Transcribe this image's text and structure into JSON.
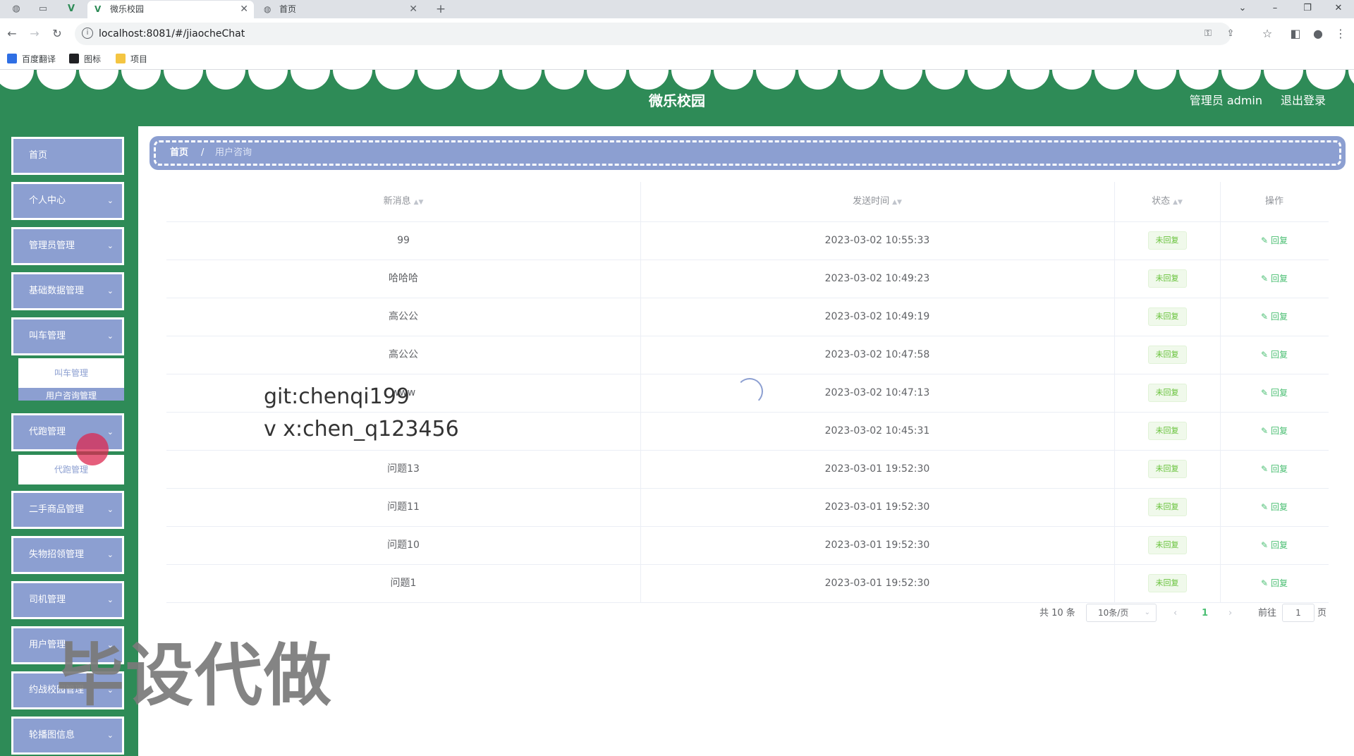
{
  "browser": {
    "tabs": [
      {
        "title": "微乐校园",
        "active": true
      },
      {
        "title": "首页",
        "active": false
      }
    ],
    "url": "localhost:8081/#/jiaocheChat",
    "bookmarks": [
      "百度翻译",
      "图标",
      "项目"
    ]
  },
  "header": {
    "title": "微乐校园",
    "user": "管理员 admin",
    "logout": "退出登录"
  },
  "sidebar": {
    "items": [
      {
        "label": "首页",
        "has_children": false
      },
      {
        "label": "个人中心",
        "has_children": true
      },
      {
        "label": "管理员管理",
        "has_children": true
      },
      {
        "label": "基础数据管理",
        "has_children": true
      },
      {
        "label": "叫车管理",
        "has_children": true
      },
      {
        "label": "代跑管理",
        "has_children": true
      },
      {
        "label": "二手商品管理",
        "has_children": true
      },
      {
        "label": "失物招领管理",
        "has_children": true
      },
      {
        "label": "司机管理",
        "has_children": true
      },
      {
        "label": "用户管理",
        "has_children": true
      },
      {
        "label": "约战校园管理",
        "has_children": true
      },
      {
        "label": "轮播图信息",
        "has_children": true
      }
    ],
    "submenu_jiaoche": [
      "叫车管理",
      "用户咨询管理"
    ],
    "submenu_daipao": [
      "代跑管理"
    ]
  },
  "breadcrumb": {
    "home": "首页",
    "separator": "/",
    "current": "用户咨询"
  },
  "table": {
    "columns": [
      "新消息",
      "发送时间",
      "状态",
      "操作"
    ],
    "rows": [
      {
        "message": "99",
        "time": "2023-03-02 10:55:33",
        "status": "未回复",
        "action": "回复"
      },
      {
        "message": "哈哈哈",
        "time": "2023-03-02 10:49:23",
        "status": "未回复",
        "action": "回复"
      },
      {
        "message": "高公公",
        "time": "2023-03-02 10:49:19",
        "status": "未回复",
        "action": "回复"
      },
      {
        "message": "高公公",
        "time": "2023-03-02 10:47:58",
        "status": "未回复",
        "action": "回复"
      },
      {
        "message": "www",
        "time": "2023-03-02 10:47:13",
        "status": "未回复",
        "action": "回复"
      },
      {
        "message": "",
        "time": "2023-03-02 10:45:31",
        "status": "未回复",
        "action": "回复"
      },
      {
        "message": "问题13",
        "time": "2023-03-01 19:52:30",
        "status": "未回复",
        "action": "回复"
      },
      {
        "message": "问题11",
        "time": "2023-03-01 19:52:30",
        "status": "未回复",
        "action": "回复"
      },
      {
        "message": "问题10",
        "time": "2023-03-01 19:52:30",
        "status": "未回复",
        "action": "回复"
      },
      {
        "message": "问题1",
        "time": "2023-03-01 19:52:30",
        "status": "未回复",
        "action": "回复"
      }
    ]
  },
  "pagination": {
    "total": "共 10 条",
    "page_size": "10条/页",
    "current_page": "1",
    "goto_label": "前往",
    "goto_value": "1",
    "page_suffix": "页"
  },
  "overlay": {
    "line1": "git:chenqi199",
    "line2": "v x:chen_q123456",
    "big_text": "毕设代做"
  },
  "colors": {
    "theme_green": "#2e8b57",
    "menu_blue": "#8c9fd1",
    "status_green": "#67c23a"
  }
}
